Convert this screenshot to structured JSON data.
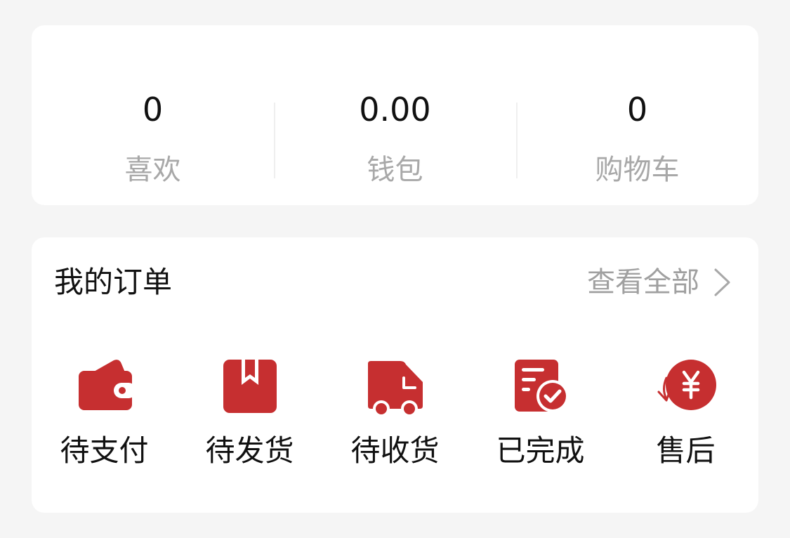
{
  "stats": [
    {
      "value": "0",
      "label": "喜欢"
    },
    {
      "value": "0.00",
      "label": "钱包"
    },
    {
      "value": "0",
      "label": "购物车"
    }
  ],
  "orders": {
    "title": "我的订单",
    "view_all": "查看全部",
    "items": [
      {
        "label": "待支付",
        "icon": "wallet-icon"
      },
      {
        "label": "待发货",
        "icon": "package-icon"
      },
      {
        "label": "待收货",
        "icon": "truck-icon"
      },
      {
        "label": "已完成",
        "icon": "completed-document-icon"
      },
      {
        "label": "售后",
        "icon": "yuan-refund-icon"
      }
    ]
  },
  "colors": {
    "accent": "#c62f30",
    "background": "#f5f5f5",
    "card": "#ffffff",
    "muted_text": "#a8a8a8",
    "primary_text": "#111111"
  }
}
